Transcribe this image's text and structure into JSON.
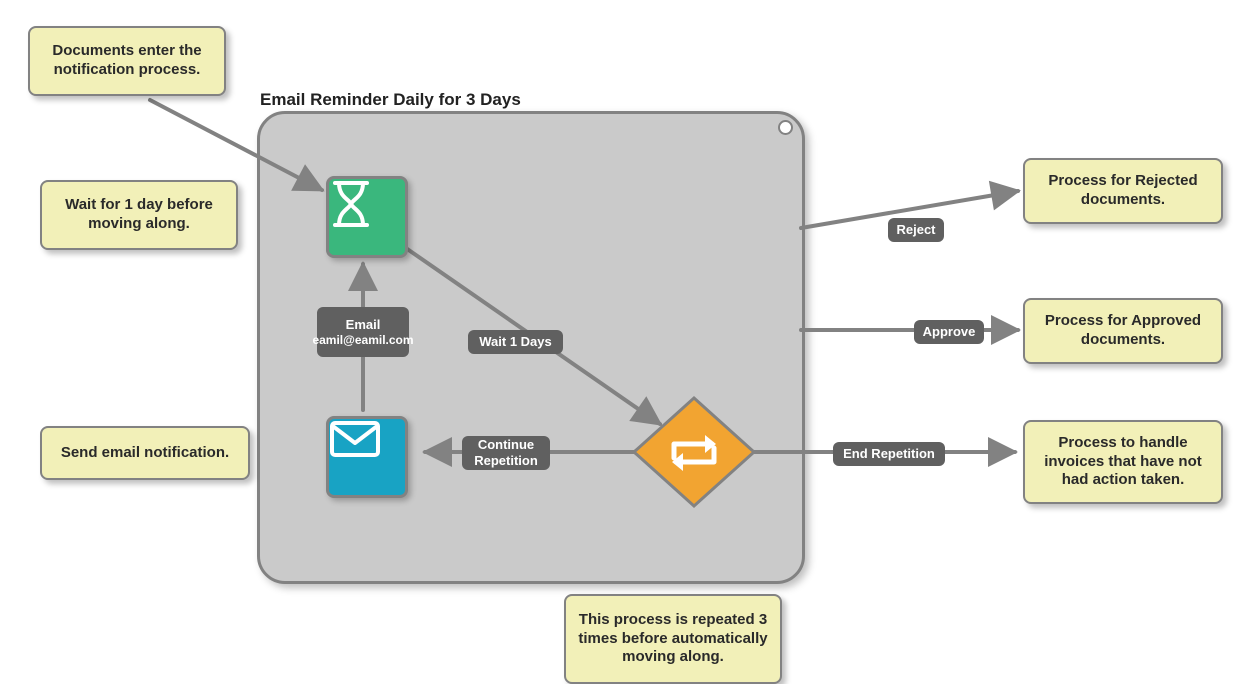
{
  "notes": {
    "n1": "Documents enter the notification process.",
    "n2": "Wait for 1 day before moving along.",
    "n3": "Send email notification.",
    "n4": "This process is repeated 3 times before automatically moving along.",
    "n5": "Process for Rejected documents.",
    "n6": "Process for Approved documents.",
    "n7": "Process to handle invoices that have not had action taken."
  },
  "container": {
    "title": "Email Reminder Daily for 3 Days"
  },
  "edge_labels": {
    "wait": "Wait 1 Days",
    "email_line1": "Email",
    "email_line2": "eamil@eamil.com",
    "continue": "Continue Repetition",
    "end": "End Repetition",
    "reject": "Reject",
    "approve": "Approve"
  },
  "icons": {
    "hourglass": "hourglass-icon",
    "envelope": "envelope-icon",
    "loop": "loop-arrows-icon"
  }
}
